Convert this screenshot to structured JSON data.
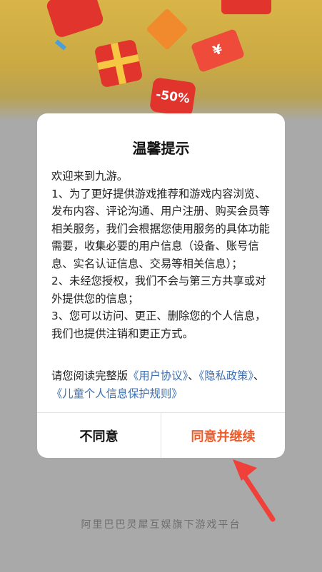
{
  "background": {
    "coupon_text": "-50%",
    "ticket_symbol": "¥"
  },
  "dialog": {
    "title": "温馨提示",
    "paragraphs": [
      "欢迎来到九游。",
      "1、为了更好提供游戏推荐和游戏内容浏览、发布内容、评论沟通、用户注册、购买会员等相关服务，我们会根据您使用服务的具体功能需要，收集必要的用户信息（设备、账号信息、实名认证信息、交易等相关信息）；",
      "2、未经您授权，我们不会与第三方共享或对外提供您的信息；",
      "3、您可以访问、更正、删除您的个人信息，我们也提供注销和更正方式。"
    ],
    "read_prefix": "请您阅读完整版",
    "link_user_agreement": "《用户协议》",
    "separator1": "、",
    "link_privacy": "《隐私政策》",
    "separator2": "、",
    "link_children": "《儿童个人信息保护规则》",
    "disagree_label": "不同意",
    "agree_label": "同意并继续"
  },
  "footer": {
    "text": "阿里巴巴灵犀互娱旗下游戏平台"
  },
  "colors": {
    "accent": "#f05a28",
    "link": "#3b6fb3",
    "overlay": "#a9a9a9"
  }
}
